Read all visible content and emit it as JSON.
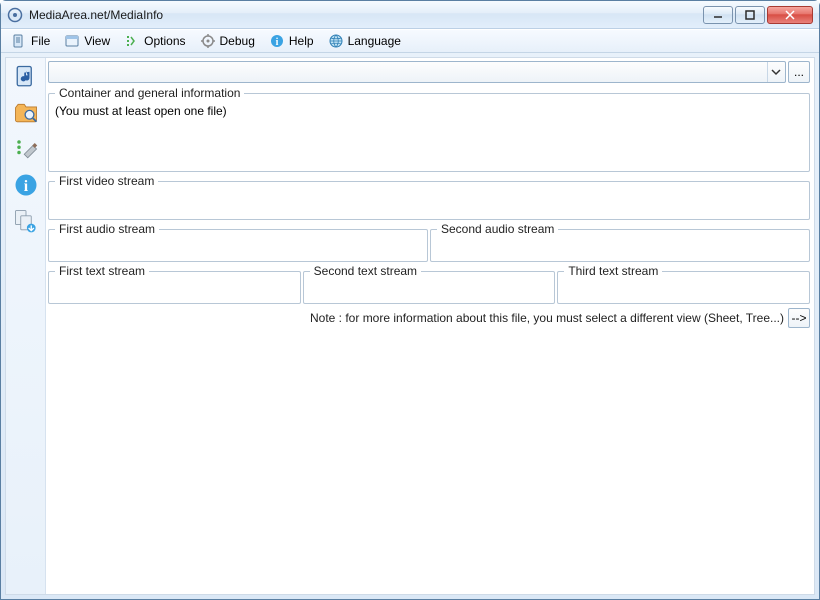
{
  "window": {
    "title": "MediaArea.net/MediaInfo"
  },
  "menu": {
    "file": "File",
    "view": "View",
    "options": "Options",
    "debug": "Debug",
    "help": "Help",
    "language": "Language"
  },
  "panes": {
    "general_legend": "Container and general information",
    "general_body": "(You must at least open one file)",
    "video_legend": "First video stream",
    "audio1_legend": "First audio stream",
    "audio2_legend": "Second audio stream",
    "text1_legend": "First text stream",
    "text2_legend": "Second text stream",
    "text3_legend": "Third text stream"
  },
  "note": "Note : for more information about this file, you must select a different view (Sheet, Tree...)",
  "browse_label": "...",
  "go_label": "-->"
}
